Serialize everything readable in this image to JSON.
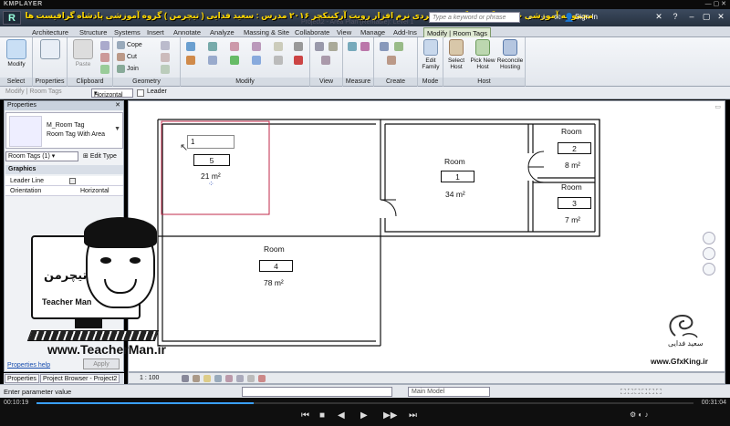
{
  "player": {
    "brand": "KMPLAYER",
    "elapsed": "00:10:19",
    "total": "00:31:04",
    "progress": 0.33
  },
  "titlebar": {
    "logo": "R",
    "overlay_text": "مجموعه آموزشی جامع ، گام به گام و کاربردی نرم افزار رویت آرکیتکچر ۲۰۱۶ مدرس : سعید فدایی ( تیچرمن ) گروه آموزشی پادشاه گرافیست ها",
    "doc_title": "Project2 - Area Plan (Rentable): Level 1",
    "search_placeholder": "Type a keyword or phrase",
    "sign_in": "Sign In"
  },
  "tabs": [
    "Architecture",
    "Structure",
    "Systems",
    "Insert",
    "Annotate",
    "Analyze",
    "Massing & Site",
    "Collaborate",
    "View",
    "Manage",
    "Add-Ins",
    "Modify | Room Tags"
  ],
  "ribbon": {
    "modify": "Modify",
    "properties": "Properties",
    "paste": "Paste",
    "cope": "Cope",
    "cut": "Cut",
    "join": "Join",
    "edit_family": "Edit Family",
    "select_host": "Select Host",
    "pick_new_host": "Pick New Host",
    "reconcile_hosting": "Reconcile Hosting",
    "groups": {
      "select": "Select",
      "properties": "Properties",
      "clipboard": "Clipboard",
      "geometry": "Geometry",
      "modify": "Modify",
      "view": "View",
      "measure": "Measure",
      "create": "Create",
      "mode": "Mode",
      "host": "Host"
    }
  },
  "options_bar": {
    "context": "Modify | Room Tags",
    "orientation": "Horizontal",
    "leader_label": "Leader"
  },
  "properties": {
    "header": "Properties",
    "type_name": "M_Room Tag",
    "type_sub": "Room Tag With Area",
    "filter": "Room Tags (1)",
    "edit_type": "Edit Type",
    "section": "Graphics",
    "rows": [
      {
        "key": "Leader Line",
        "value": ""
      },
      {
        "key": "Orientation",
        "value": "Horizontal"
      }
    ],
    "help": "Properties help",
    "apply": "Apply"
  },
  "bottom_tabs": [
    "Properties",
    "Project Browser - Project2"
  ],
  "rooms": [
    {
      "name": "",
      "number": "5",
      "area": "21 m²",
      "edit_value": "1"
    },
    {
      "name": "Room",
      "number": "1",
      "area": "34 m²"
    },
    {
      "name": "Room",
      "number": "2",
      "area": "8 m²"
    },
    {
      "name": "Room",
      "number": "3",
      "area": "7 m²"
    },
    {
      "name": "Room",
      "number": "4",
      "area": "78 m²"
    }
  ],
  "viewbar": {
    "scale": "1 : 100"
  },
  "status": {
    "text": "Enter parameter value",
    "model": "Main Model"
  },
  "watermark": {
    "teacher_fa": "تیچرمن",
    "teacher_en": "Teacher Man",
    "teacher_url": "www.TeacherMan.ir",
    "gfx_fa": "سعید فدایی",
    "gfx_url": "www.GfxKing.ir"
  },
  "colors": {
    "ribbon_active_tab": "#dfe9d3",
    "selection_red": "#c0294a",
    "overlay_yellow": "#ffd800",
    "progress_blue": "#3aa0ff"
  }
}
